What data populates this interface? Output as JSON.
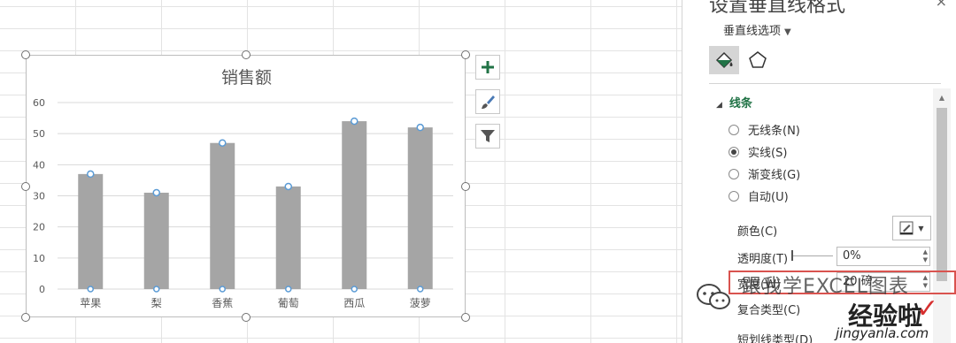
{
  "pane": {
    "title": "设置垂直线格式",
    "close": "×",
    "dropdown_label": "垂直线选项",
    "tabs": [
      {
        "name": "fill-line-tab",
        "icon": "paint-bucket-icon",
        "active": true
      },
      {
        "name": "effects-tab",
        "icon": "pentagon-icon",
        "active": false
      }
    ],
    "section_title": "线条",
    "line_options": [
      {
        "label": "无线条(N)",
        "checked": false
      },
      {
        "label": "实线(S)",
        "checked": true
      },
      {
        "label": "渐变线(G)",
        "checked": false
      },
      {
        "label": "自动(U)",
        "checked": false
      }
    ],
    "color_label": "颜色(C)",
    "transparency_label": "透明度(T)",
    "transparency_value": "0%",
    "width_label": "宽度(W)",
    "width_value": "20 磅",
    "compound_label": "复合类型(C)",
    "dash_label": "短划线类型(D)"
  },
  "chart_side_buttons": [
    {
      "name": "chart-elements-button",
      "icon": "plus-icon"
    },
    {
      "name": "chart-styles-button",
      "icon": "brush-icon"
    },
    {
      "name": "chart-filters-button",
      "icon": "filter-icon"
    }
  ],
  "watermark": {
    "text": "跟我学EXCEL图表",
    "brand": "经验啦",
    "site": "jingyanla.com"
  },
  "colors": {
    "bar": "#a5a5a5",
    "marker": "#5b9bd5",
    "accent": "#217346",
    "highlight": "#d9534f"
  },
  "chart_data": {
    "type": "bar",
    "title": "销售额",
    "categories": [
      "苹果",
      "梨",
      "香蕉",
      "葡萄",
      "西瓜",
      "菠萝"
    ],
    "values": [
      37,
      31,
      47,
      33,
      54,
      52
    ],
    "ylim": [
      0,
      60
    ],
    "yticks": [
      0,
      10,
      20,
      30,
      40,
      50,
      60
    ],
    "grid": true,
    "legend": "none",
    "xlabel": "",
    "ylabel": ""
  }
}
